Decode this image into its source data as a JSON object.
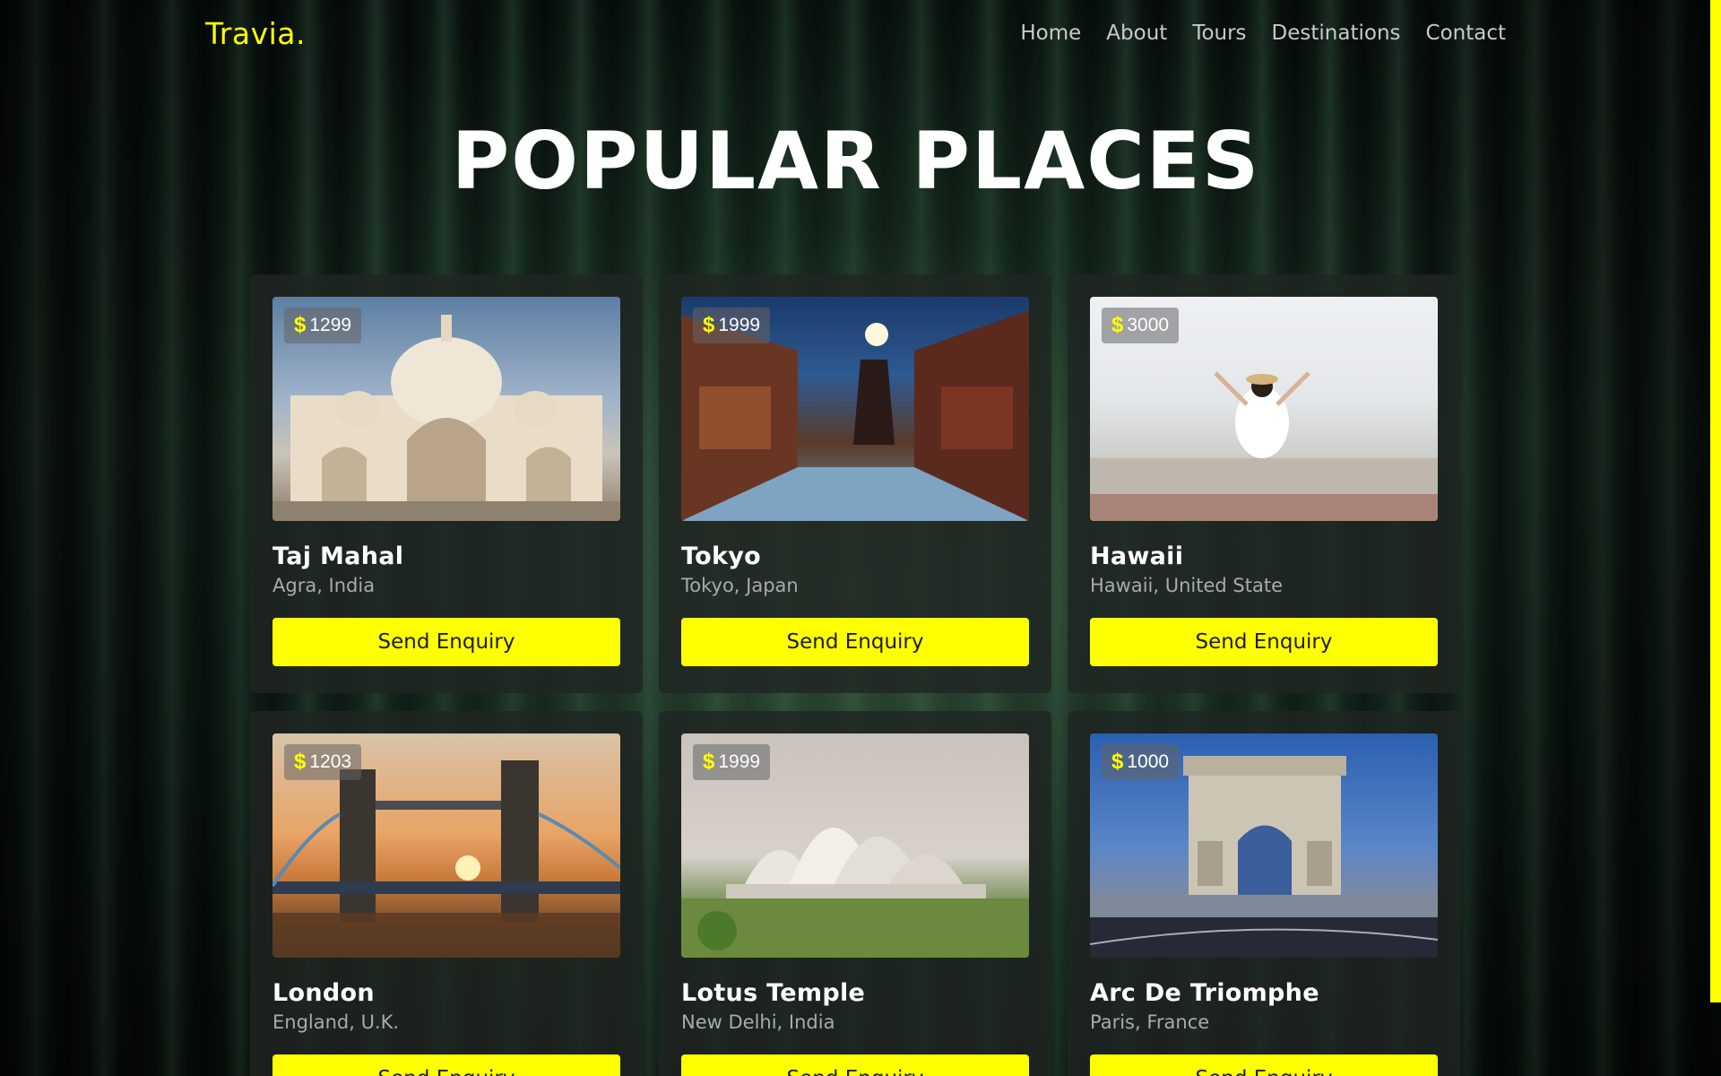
{
  "header": {
    "logo": "Travia.",
    "nav": [
      "Home",
      "About",
      "Tours",
      "Destinations",
      "Contact"
    ]
  },
  "page_title": "POPULAR PLACES",
  "currency_symbol": "$",
  "button_label": "Send Enquiry",
  "places": [
    {
      "name": "Taj Mahal",
      "location": "Agra, India",
      "price": "1299",
      "image": "taj-mahal-photo"
    },
    {
      "name": "Tokyo",
      "location": "Tokyo, Japan",
      "price": "1999",
      "image": "tokyo-street-photo"
    },
    {
      "name": "Hawaii",
      "location": "Hawaii, United State",
      "price": "3000",
      "image": "hawaii-beach-photo"
    },
    {
      "name": "London",
      "location": "England, U.K.",
      "price": "1203",
      "image": "tower-bridge-photo"
    },
    {
      "name": "Lotus Temple",
      "location": "New Delhi, India",
      "price": "1999",
      "image": "lotus-temple-photo"
    },
    {
      "name": "Arc De Triomphe",
      "location": "Paris, France",
      "price": "1000",
      "image": "arc-de-triomphe-photo"
    }
  ],
  "colors": {
    "accent": "#ffff00",
    "card_bg": "#202622",
    "text_primary": "#ffffff",
    "text_secondary": "#a9aba9"
  }
}
